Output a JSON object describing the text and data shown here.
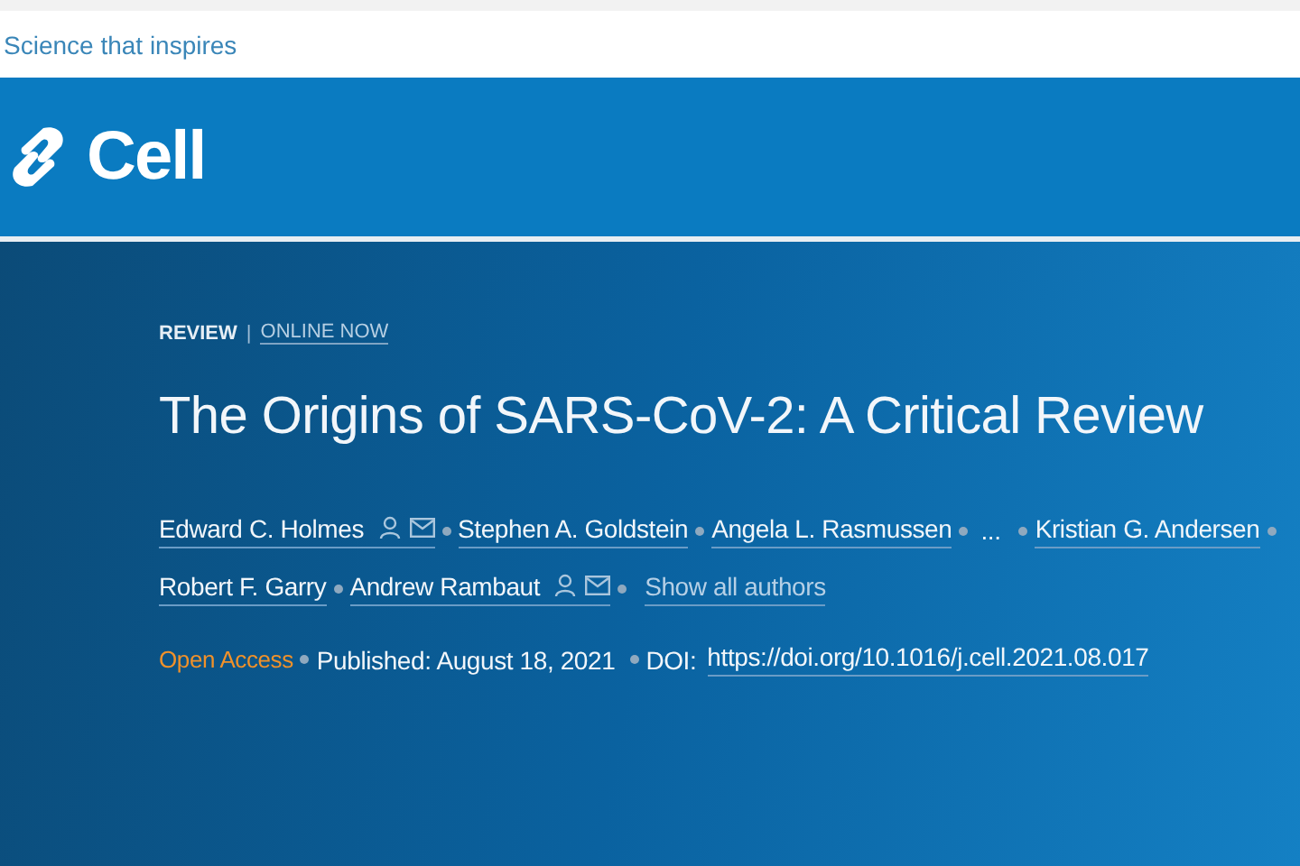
{
  "top_bar": {
    "tagline": "Science that inspires"
  },
  "header": {
    "journal": "Cell"
  },
  "article": {
    "type": "REVIEW",
    "separator": "|",
    "status": "ONLINE NOW",
    "title": "The Origins of SARS-CoV-2: A Critical Review",
    "author_rows": [
      [
        {
          "kind": "author",
          "name": "Edward C. Holmes",
          "corresponding": true
        },
        {
          "kind": "author",
          "name": "Stephen A. Goldstein",
          "corresponding": false
        },
        {
          "kind": "author",
          "name": "Angela L. Rasmussen",
          "corresponding": false
        },
        {
          "kind": "ellipsis",
          "text": "..."
        },
        {
          "kind": "author",
          "name": "Kristian G. Andersen",
          "corresponding": false
        }
      ],
      [
        {
          "kind": "author",
          "name": "Robert F. Garry",
          "corresponding": false
        },
        {
          "kind": "author",
          "name": "Andrew Rambaut",
          "corresponding": true
        },
        {
          "kind": "link",
          "text": "Show all authors"
        }
      ]
    ],
    "access": "Open Access",
    "published": "Published: August 18, 2021",
    "doi_label": "DOI:",
    "doi": "https://doi.org/10.1016/j.cell.2021.08.017"
  }
}
